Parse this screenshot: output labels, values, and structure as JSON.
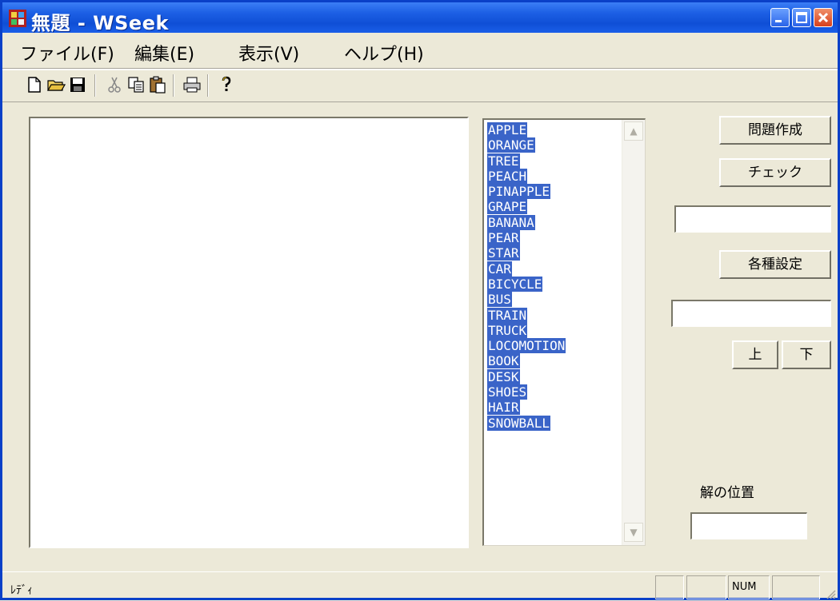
{
  "window": {
    "title": "無題 - WSeek"
  },
  "menu": [
    "ファイル(F)",
    "編集(E)",
    "表示(V)",
    "ヘルプ(H)"
  ],
  "toolbar": {
    "icons": [
      "new-file-icon",
      "open-folder-icon",
      "save-icon",
      "cut-icon",
      "copy-icon",
      "paste-icon",
      "print-icon",
      "help-icon"
    ]
  },
  "words": [
    "APPLE",
    "ORANGE",
    "TREE",
    "PEACH",
    "PINAPPLE",
    "GRAPE",
    "BANANA",
    "PEAR",
    "STAR",
    "CAR",
    "BICYCLE",
    "BUS",
    "TRAIN",
    "TRUCK",
    "LOCOMOTION",
    "BOOK",
    "DESK",
    "SHOES",
    "HAIR",
    "SNOWBALL"
  ],
  "controls": {
    "create_label": "問題作成",
    "check_label": "チェック",
    "settings_label": "各種設定",
    "up_label": "上",
    "down_label": "下",
    "answer_position_label": "解の位置",
    "field1_value": "",
    "field2_value": "",
    "answer_position_value": ""
  },
  "status": {
    "text": "ﾚﾃﾞｨ",
    "num": "NUM"
  }
}
